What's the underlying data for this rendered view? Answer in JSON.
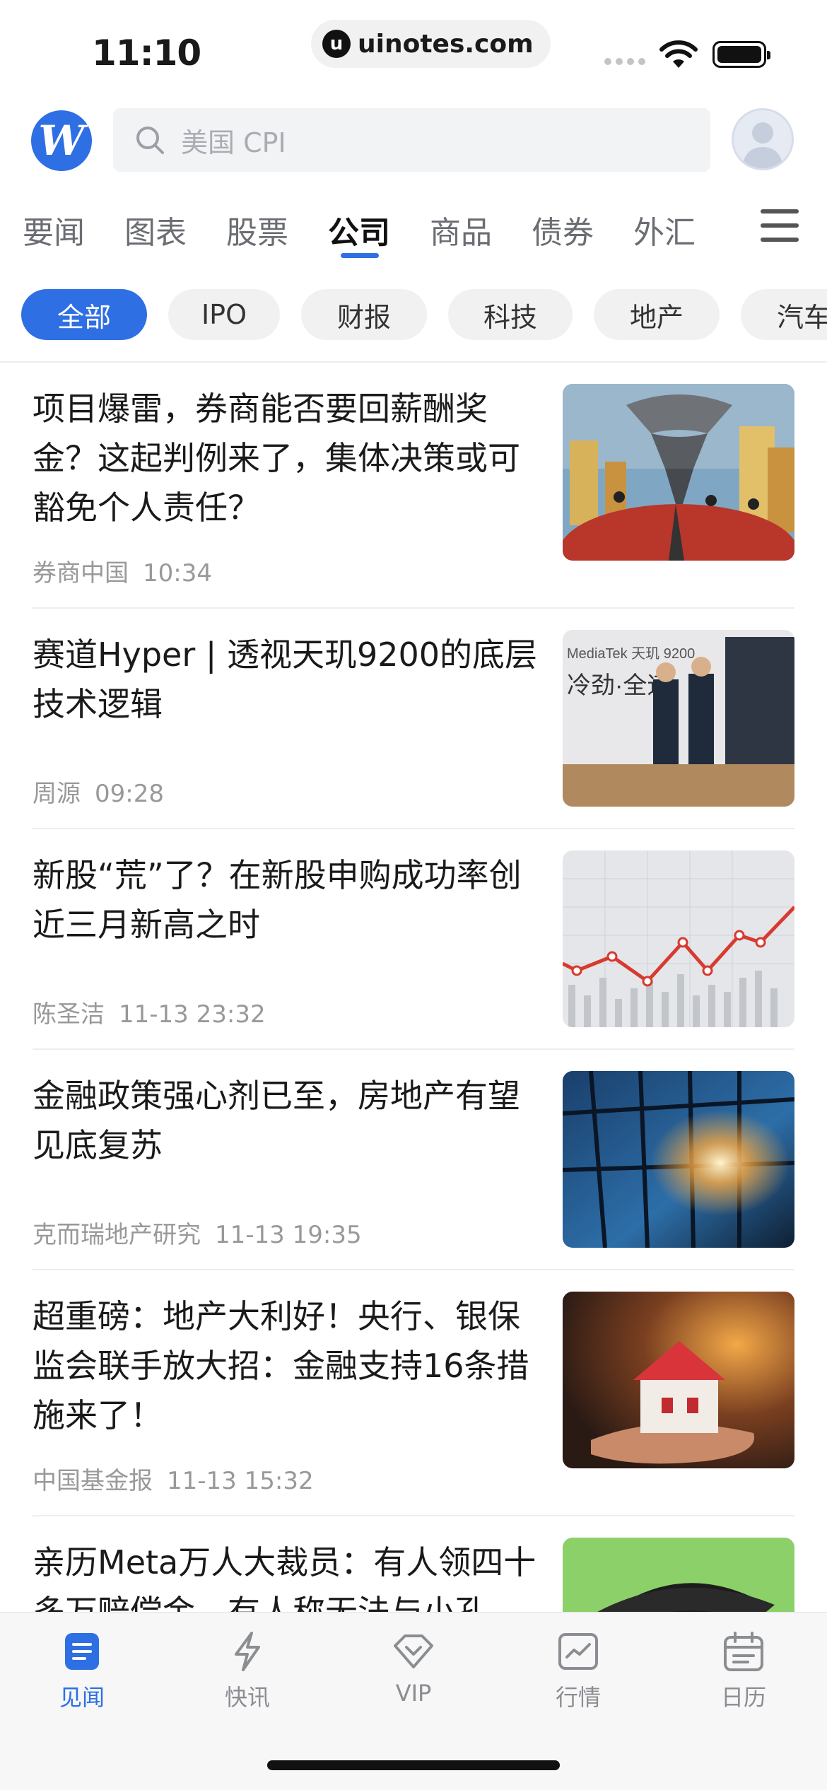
{
  "status_bar": {
    "time": "11:10",
    "url": "uinotes.com"
  },
  "header": {
    "logo_icon": "wallstreetcn-logo",
    "search_placeholder": "美国 CPI",
    "avatar_icon": "user-avatar-icon"
  },
  "category_tabs": [
    "要闻",
    "图表",
    "股票",
    "公司",
    "商品",
    "债券",
    "外汇"
  ],
  "active_category": "公司",
  "filter_chips": [
    "全部",
    "IPO",
    "财报",
    "科技",
    "地产",
    "汽车"
  ],
  "active_chip": "全部",
  "articles": [
    {
      "title": "项目爆雷，券商能否要回薪酬奖金？这起判例来了，集体决策或可豁免个人责任？",
      "source": "券商中国",
      "time": "10:34",
      "thumb": "tornado-city-illustration"
    },
    {
      "title": "赛道Hyper | 透视天玑9200的底层技术逻辑",
      "source": "周源",
      "time": "09:28",
      "thumb": "mediatek-launch-photo"
    },
    {
      "title": "新股“荒”了？在新股申购成功率创近三月新高之时",
      "source": "陈圣洁",
      "time": "11-13 23:32",
      "thumb": "stock-chart-image"
    },
    {
      "title": "金融政策强心剂已至，房地产有望见底复苏",
      "source": "克而瑞地产研究",
      "time": "11-13 19:35",
      "thumb": "glass-building-image"
    },
    {
      "title": "超重磅：地产大利好！央行、银保监会联手放大招：金融支持16条措施来了！",
      "source": "中国基金报",
      "time": "11-13 15:32",
      "thumb": "house-in-hands-image"
    },
    {
      "title": "亲历Meta万人大裁员：有人领四十多万赔偿金，有人称无法与小孔",
      "source": "",
      "time": "",
      "thumb": "graduation-cap-image"
    }
  ],
  "bottom_nav": [
    {
      "label": "见闻",
      "icon": "news-doc-icon",
      "active": true
    },
    {
      "label": "快讯",
      "icon": "lightning-icon",
      "active": false
    },
    {
      "label": "VIP",
      "icon": "diamond-icon",
      "active": false
    },
    {
      "label": "行情",
      "icon": "market-chart-icon",
      "active": false
    },
    {
      "label": "日历",
      "icon": "calendar-icon",
      "active": false
    }
  ],
  "colors": {
    "accent": "#2f6fe4",
    "text": "#1a1a1a",
    "muted": "#999999",
    "chip_bg": "#f1f1f2"
  }
}
